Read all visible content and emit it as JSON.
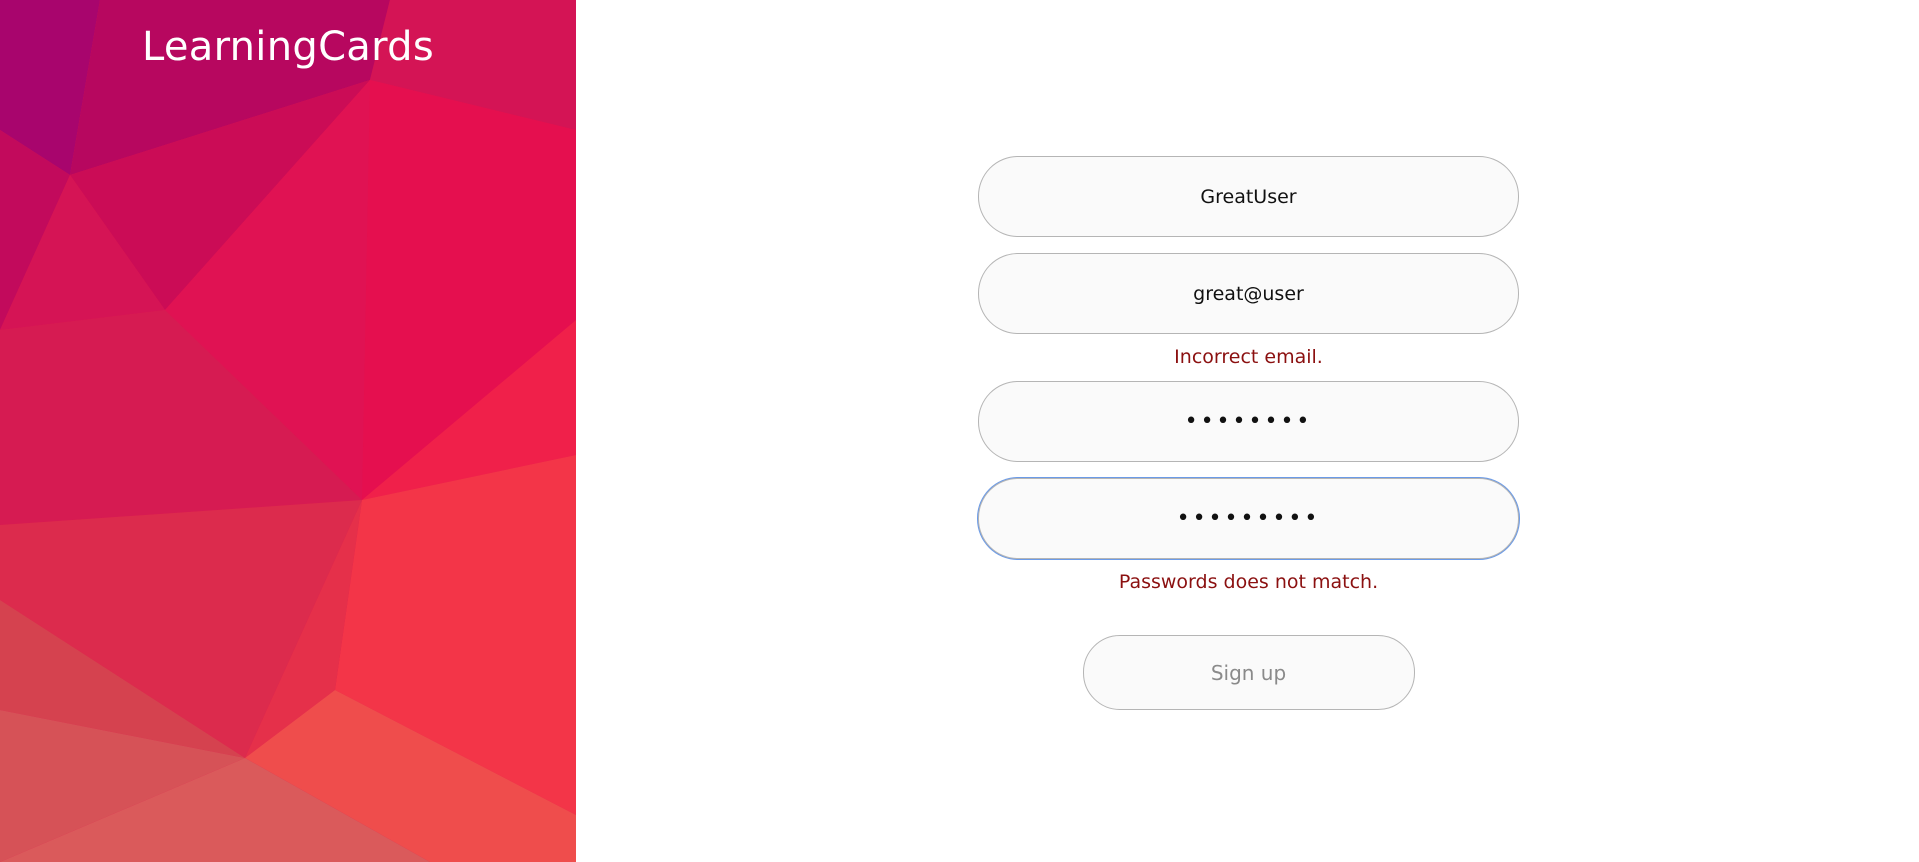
{
  "brand": {
    "title": "LearningCards",
    "panel_colors": [
      "#a8056d",
      "#e3174f",
      "#f5364a",
      "#d95b60"
    ]
  },
  "form": {
    "username": {
      "value": "GreatUser"
    },
    "email": {
      "value": "great@user",
      "error": "Incorrect email."
    },
    "password": {
      "value": "••••••••"
    },
    "confirm_password": {
      "value": "•••••••••",
      "error": "Passwords does not match.",
      "focused": true
    },
    "submit_label": "Sign up",
    "error_color": "#8b1010",
    "focus_color": "#6b9be8"
  }
}
